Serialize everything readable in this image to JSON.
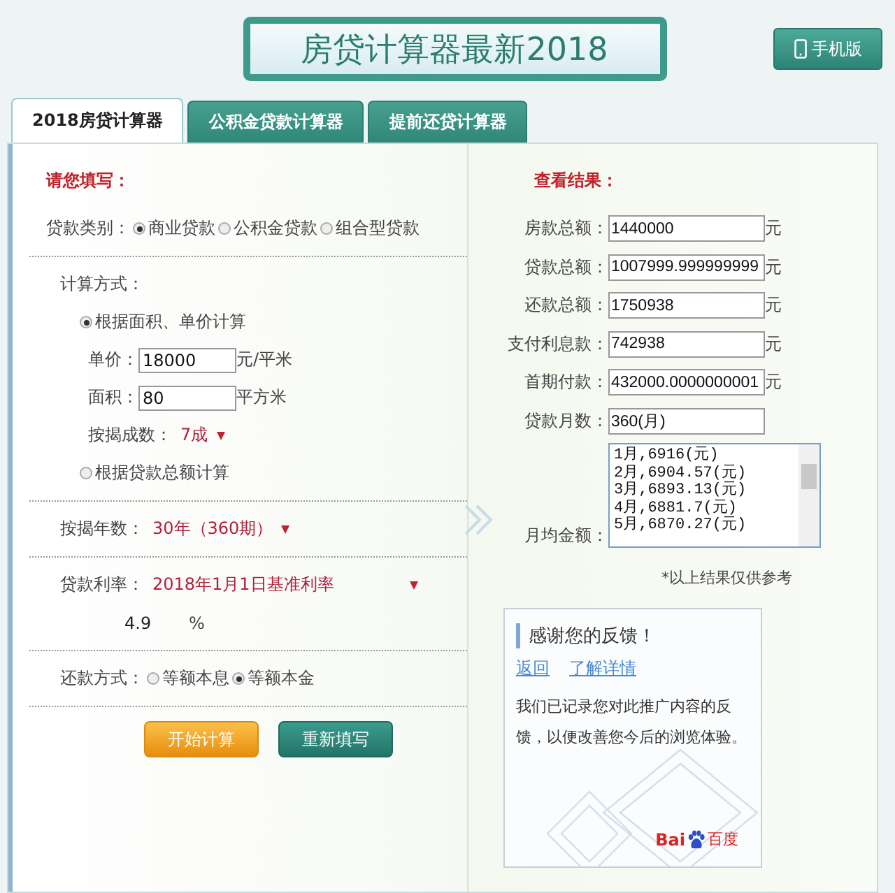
{
  "header": {
    "title": "房贷计算器最新2018",
    "mobile_button": "手机版"
  },
  "tabs": [
    {
      "label": "2018房贷计算器",
      "selected": true
    },
    {
      "label": "公积金贷款计算器",
      "selected": false
    },
    {
      "label": "提前还贷计算器",
      "selected": false
    }
  ],
  "form": {
    "heading": "请您填写：",
    "loan_type": {
      "label": "贷款类别：",
      "options": [
        {
          "label": "商业贷款",
          "selected": true
        },
        {
          "label": "公积金贷款",
          "selected": false
        },
        {
          "label": "组合型贷款",
          "selected": false
        }
      ]
    },
    "calc_method": {
      "label": "计算方式：",
      "by_area": {
        "label": "根据面积、单价计算",
        "selected": true
      },
      "unit_price": {
        "label": "单价：",
        "value": "18000",
        "unit": "元/平米"
      },
      "area": {
        "label": "面积：",
        "value": "80",
        "unit": "平方米"
      },
      "down_ratio": {
        "label": "按揭成数：",
        "value": "7成"
      },
      "by_total": {
        "label": "根据贷款总额计算",
        "selected": false
      }
    },
    "years": {
      "label": "按揭年数：",
      "value": "30年（360期）"
    },
    "rate": {
      "label": "贷款利率：",
      "value": "2018年1月1日基准利率",
      "rate_value": "4.9",
      "unit": "%"
    },
    "repay": {
      "label": "还款方式：",
      "options": [
        {
          "label": "等额本息",
          "selected": false
        },
        {
          "label": "等额本金",
          "selected": true
        }
      ]
    },
    "buttons": [
      {
        "label": "开始计算",
        "kind": "primary"
      },
      {
        "label": "重新填写",
        "kind": "secondary"
      }
    ]
  },
  "results": {
    "heading": "查看结果：",
    "rows": [
      {
        "label": "房款总额：",
        "value": "1440000",
        "unit": "元"
      },
      {
        "label": "贷款总额：",
        "value": "1007999.999999999",
        "unit": "元"
      },
      {
        "label": "还款总额：",
        "value": "1750938",
        "unit": "元"
      },
      {
        "label": "支付利息款：",
        "value": "742938",
        "unit": "元"
      },
      {
        "label": "首期付款：",
        "value": "432000.0000000001",
        "unit": "元"
      },
      {
        "label": "贷款月数：",
        "value": "360(月)"
      }
    ],
    "monthly_label": "月均金额：",
    "monthly": [
      "1月,6916(元)",
      "2月,6904.57(元)",
      "3月,6893.13(元)",
      "4月,6881.7(元)",
      "5月,6870.27(元)"
    ],
    "note": "*以上结果仅供参考"
  },
  "feedback": {
    "title": "感谢您的反馈！",
    "links": [
      "返回",
      "了解详情"
    ],
    "text": "我们已记录您对此推广内容的反馈，以便改善您今后的浏览体验。",
    "brand_latin": "Bai",
    "brand_cjk": "百度"
  }
}
